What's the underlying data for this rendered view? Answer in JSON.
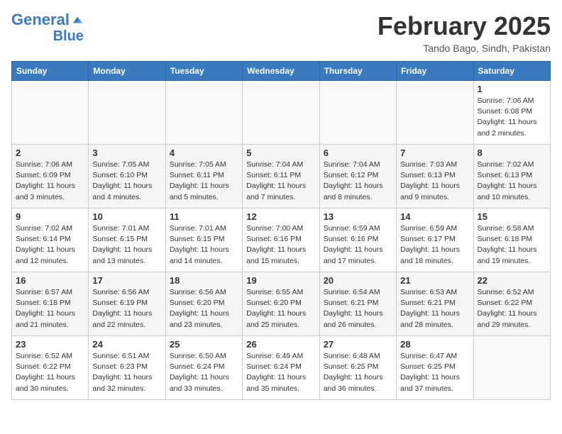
{
  "header": {
    "logo_line1": "General",
    "logo_line2": "Blue",
    "month_title": "February 2025",
    "location": "Tando Bago, Sindh, Pakistan"
  },
  "weekdays": [
    "Sunday",
    "Monday",
    "Tuesday",
    "Wednesday",
    "Thursday",
    "Friday",
    "Saturday"
  ],
  "weeks": [
    [
      {
        "day": "",
        "info": ""
      },
      {
        "day": "",
        "info": ""
      },
      {
        "day": "",
        "info": ""
      },
      {
        "day": "",
        "info": ""
      },
      {
        "day": "",
        "info": ""
      },
      {
        "day": "",
        "info": ""
      },
      {
        "day": "1",
        "info": "Sunrise: 7:06 AM\nSunset: 6:08 PM\nDaylight: 11 hours\nand 2 minutes."
      }
    ],
    [
      {
        "day": "2",
        "info": "Sunrise: 7:06 AM\nSunset: 6:09 PM\nDaylight: 11 hours\nand 3 minutes."
      },
      {
        "day": "3",
        "info": "Sunrise: 7:05 AM\nSunset: 6:10 PM\nDaylight: 11 hours\nand 4 minutes."
      },
      {
        "day": "4",
        "info": "Sunrise: 7:05 AM\nSunset: 6:11 PM\nDaylight: 11 hours\nand 5 minutes."
      },
      {
        "day": "5",
        "info": "Sunrise: 7:04 AM\nSunset: 6:11 PM\nDaylight: 11 hours\nand 7 minutes."
      },
      {
        "day": "6",
        "info": "Sunrise: 7:04 AM\nSunset: 6:12 PM\nDaylight: 11 hours\nand 8 minutes."
      },
      {
        "day": "7",
        "info": "Sunrise: 7:03 AM\nSunset: 6:13 PM\nDaylight: 11 hours\nand 9 minutes."
      },
      {
        "day": "8",
        "info": "Sunrise: 7:02 AM\nSunset: 6:13 PM\nDaylight: 11 hours\nand 10 minutes."
      }
    ],
    [
      {
        "day": "9",
        "info": "Sunrise: 7:02 AM\nSunset: 6:14 PM\nDaylight: 11 hours\nand 12 minutes."
      },
      {
        "day": "10",
        "info": "Sunrise: 7:01 AM\nSunset: 6:15 PM\nDaylight: 11 hours\nand 13 minutes."
      },
      {
        "day": "11",
        "info": "Sunrise: 7:01 AM\nSunset: 6:15 PM\nDaylight: 11 hours\nand 14 minutes."
      },
      {
        "day": "12",
        "info": "Sunrise: 7:00 AM\nSunset: 6:16 PM\nDaylight: 11 hours\nand 15 minutes."
      },
      {
        "day": "13",
        "info": "Sunrise: 6:59 AM\nSunset: 6:16 PM\nDaylight: 11 hours\nand 17 minutes."
      },
      {
        "day": "14",
        "info": "Sunrise: 6:59 AM\nSunset: 6:17 PM\nDaylight: 11 hours\nand 18 minutes."
      },
      {
        "day": "15",
        "info": "Sunrise: 6:58 AM\nSunset: 6:18 PM\nDaylight: 11 hours\nand 19 minutes."
      }
    ],
    [
      {
        "day": "16",
        "info": "Sunrise: 6:57 AM\nSunset: 6:18 PM\nDaylight: 11 hours\nand 21 minutes."
      },
      {
        "day": "17",
        "info": "Sunrise: 6:56 AM\nSunset: 6:19 PM\nDaylight: 11 hours\nand 22 minutes."
      },
      {
        "day": "18",
        "info": "Sunrise: 6:56 AM\nSunset: 6:20 PM\nDaylight: 11 hours\nand 23 minutes."
      },
      {
        "day": "19",
        "info": "Sunrise: 6:55 AM\nSunset: 6:20 PM\nDaylight: 11 hours\nand 25 minutes."
      },
      {
        "day": "20",
        "info": "Sunrise: 6:54 AM\nSunset: 6:21 PM\nDaylight: 11 hours\nand 26 minutes."
      },
      {
        "day": "21",
        "info": "Sunrise: 6:53 AM\nSunset: 6:21 PM\nDaylight: 11 hours\nand 28 minutes."
      },
      {
        "day": "22",
        "info": "Sunrise: 6:52 AM\nSunset: 6:22 PM\nDaylight: 11 hours\nand 29 minutes."
      }
    ],
    [
      {
        "day": "23",
        "info": "Sunrise: 6:52 AM\nSunset: 6:22 PM\nDaylight: 11 hours\nand 30 minutes."
      },
      {
        "day": "24",
        "info": "Sunrise: 6:51 AM\nSunset: 6:23 PM\nDaylight: 11 hours\nand 32 minutes."
      },
      {
        "day": "25",
        "info": "Sunrise: 6:50 AM\nSunset: 6:24 PM\nDaylight: 11 hours\nand 33 minutes."
      },
      {
        "day": "26",
        "info": "Sunrise: 6:49 AM\nSunset: 6:24 PM\nDaylight: 11 hours\nand 35 minutes."
      },
      {
        "day": "27",
        "info": "Sunrise: 6:48 AM\nSunset: 6:25 PM\nDaylight: 11 hours\nand 36 minutes."
      },
      {
        "day": "28",
        "info": "Sunrise: 6:47 AM\nSunset: 6:25 PM\nDaylight: 11 hours\nand 37 minutes."
      },
      {
        "day": "",
        "info": ""
      }
    ]
  ]
}
